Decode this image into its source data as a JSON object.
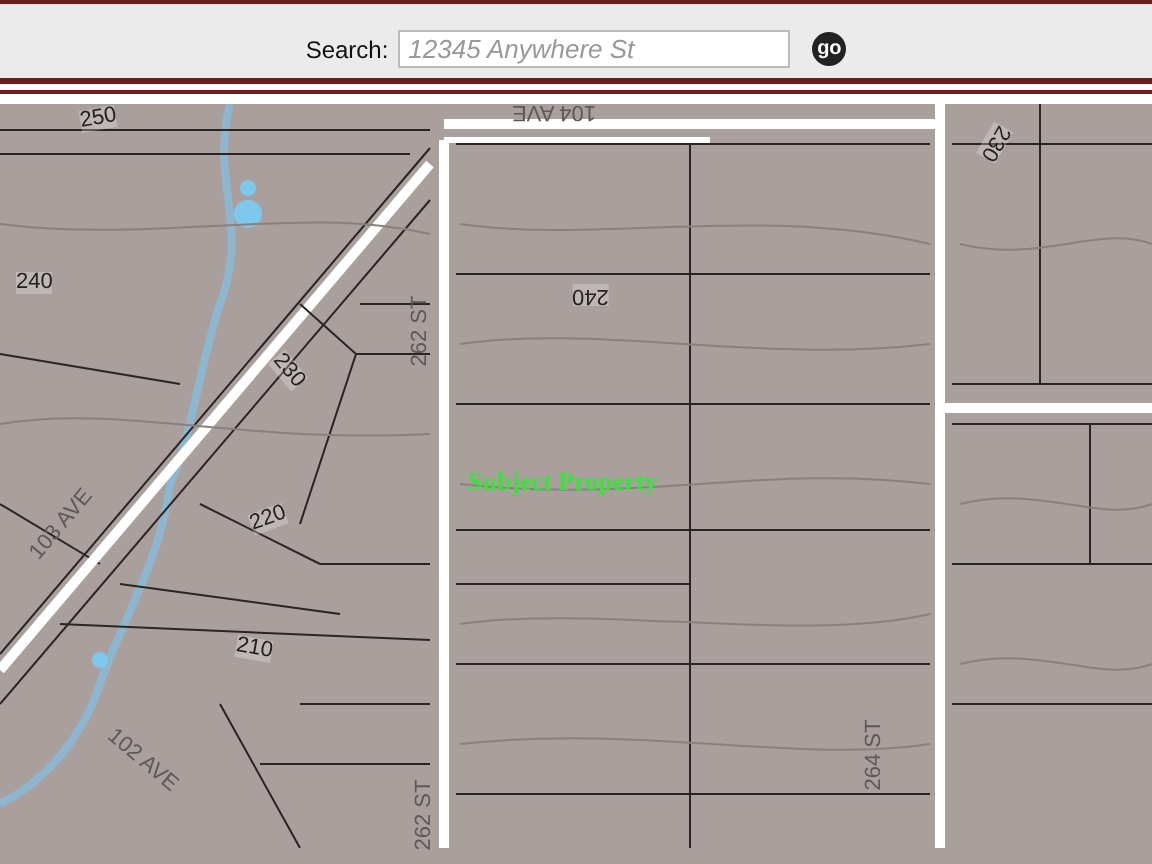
{
  "search": {
    "label": "Search:",
    "placeholder": "12345 Anywhere St",
    "button": "go"
  },
  "map": {
    "labels": [
      {
        "text": "250",
        "kind": "contour"
      },
      {
        "text": "240",
        "kind": "contour"
      },
      {
        "text": "240",
        "kind": "contour"
      },
      {
        "text": "230",
        "kind": "contour"
      },
      {
        "text": "230",
        "kind": "contour"
      },
      {
        "text": "220",
        "kind": "contour"
      },
      {
        "text": "210",
        "kind": "contour"
      },
      {
        "text": "104 AVE",
        "kind": "street"
      },
      {
        "text": "262 ST",
        "kind": "street"
      },
      {
        "text": "103 AVE",
        "kind": "street"
      },
      {
        "text": "102 AVE",
        "kind": "street"
      },
      {
        "text": "262 ST",
        "kind": "street"
      },
      {
        "text": "264 ST",
        "kind": "street"
      },
      {
        "text": "Subject Property",
        "kind": "subject"
      }
    ]
  }
}
